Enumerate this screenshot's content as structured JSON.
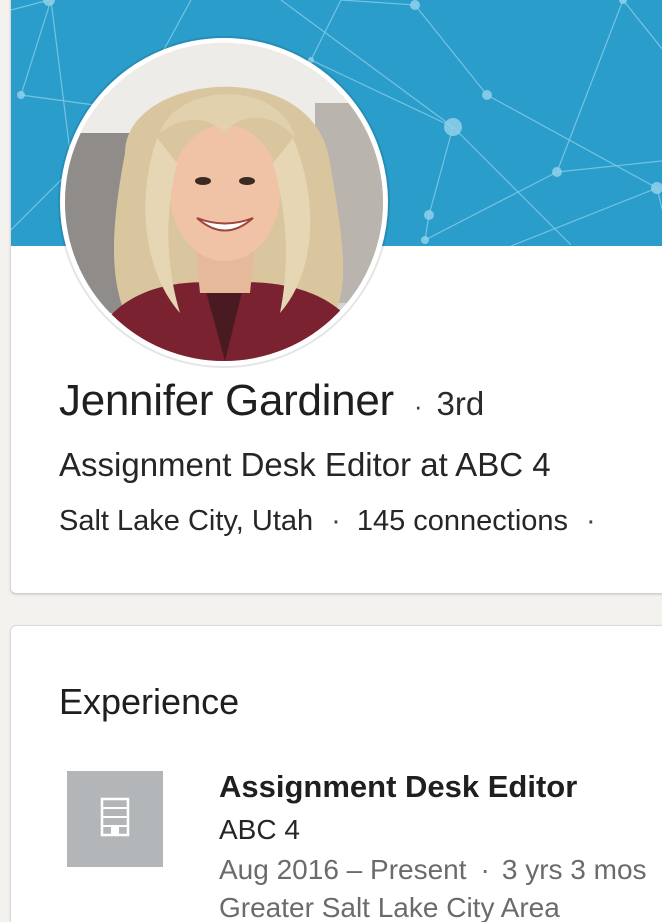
{
  "profile": {
    "name": "Jennifer Gardiner",
    "separator": "·",
    "degree": "3rd",
    "headline": "Assignment Desk Editor at ABC 4",
    "location": "Salt Lake City, Utah",
    "connections": "145 connections",
    "trailing_dot": "·",
    "cover_color": "#2a9dcb"
  },
  "experience": {
    "title": "Experience",
    "items": [
      {
        "logo_icon": "building-icon",
        "title": "Assignment Desk Editor",
        "company": "ABC 4",
        "date_range": "Aug 2016 – Present",
        "duration": "3 yrs 3 mos",
        "location": "Greater Salt Lake City Area"
      }
    ]
  }
}
